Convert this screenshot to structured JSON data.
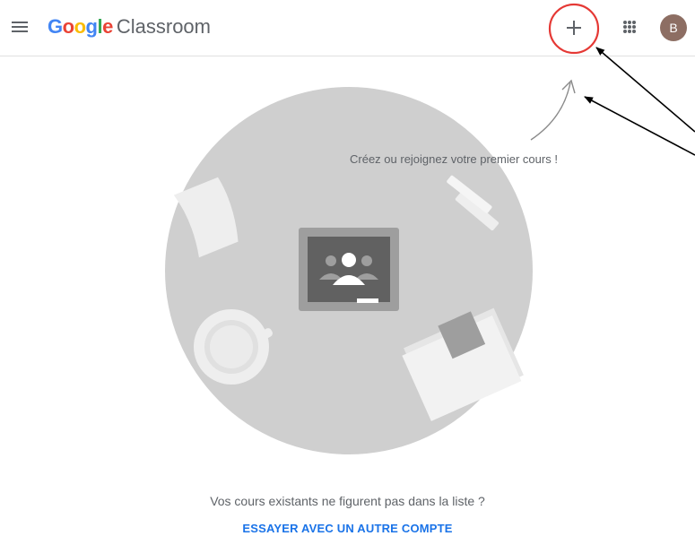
{
  "header": {
    "brand_google": "Google",
    "brand_product": "Classroom",
    "avatar_initial": "B"
  },
  "main": {
    "hint": "Créez ou rejoignez votre premier cours !",
    "question": "Vos cours existants ne figurent pas dans la liste ?",
    "switch_account": "ESSAYER AVEC UN AUTRE COMPTE"
  },
  "icons": [
    "menu-icon",
    "plus-icon",
    "apps-grid-icon",
    "classroom-board-icon"
  ],
  "colors": {
    "google_blue": "#4285f4",
    "google_red": "#ea4335",
    "google_yellow": "#fbbc05",
    "google_green": "#34a853",
    "link_blue": "#1a73e8",
    "annotation_circle": "#e53935",
    "avatar": "#8d6e63"
  }
}
